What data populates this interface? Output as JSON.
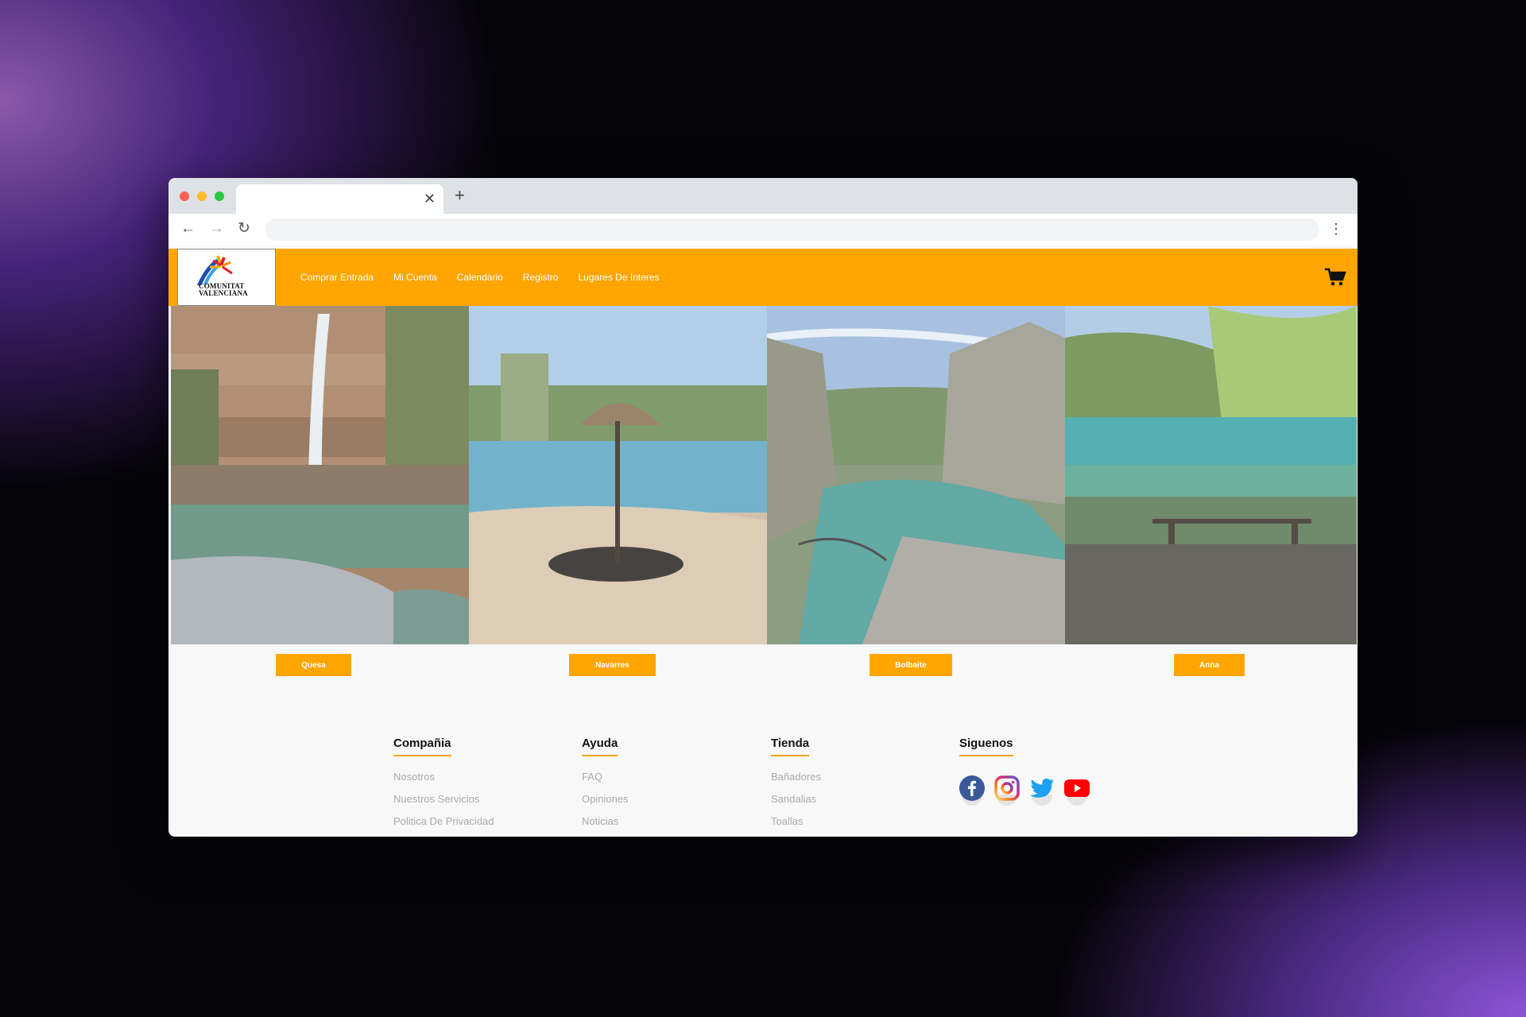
{
  "browser": {
    "tab_close": "✕",
    "new_tab": "+",
    "back": "←",
    "forward": "→",
    "reload": "↻",
    "menu": "⋮"
  },
  "header": {
    "logo_line1": "COMUNITAT",
    "logo_line2": "VALENCIANA",
    "nav": [
      "Comprar Entrada",
      "Mi Cuenta",
      "Calendario",
      "Registro",
      "Lugares De Interes"
    ],
    "accent_color": "#ffa500"
  },
  "destinations": [
    "Quesa",
    "Navarres",
    "Bolbaite",
    "Anna"
  ],
  "footer": {
    "company": {
      "title": "Compañia",
      "links": [
        "Nosotros",
        "Nuestros Servicios",
        "Politica De Privacidad"
      ]
    },
    "help": {
      "title": "Ayuda",
      "links": [
        "FAQ",
        "Opiniones",
        "Noticias"
      ]
    },
    "shop": {
      "title": "Tienda",
      "links": [
        "Bañadores",
        "Sandalias",
        "Toallas"
      ]
    },
    "social": {
      "title": "Siguenos",
      "icons": [
        "facebook-icon",
        "instagram-icon",
        "twitter-icon",
        "youtube-icon"
      ]
    }
  }
}
